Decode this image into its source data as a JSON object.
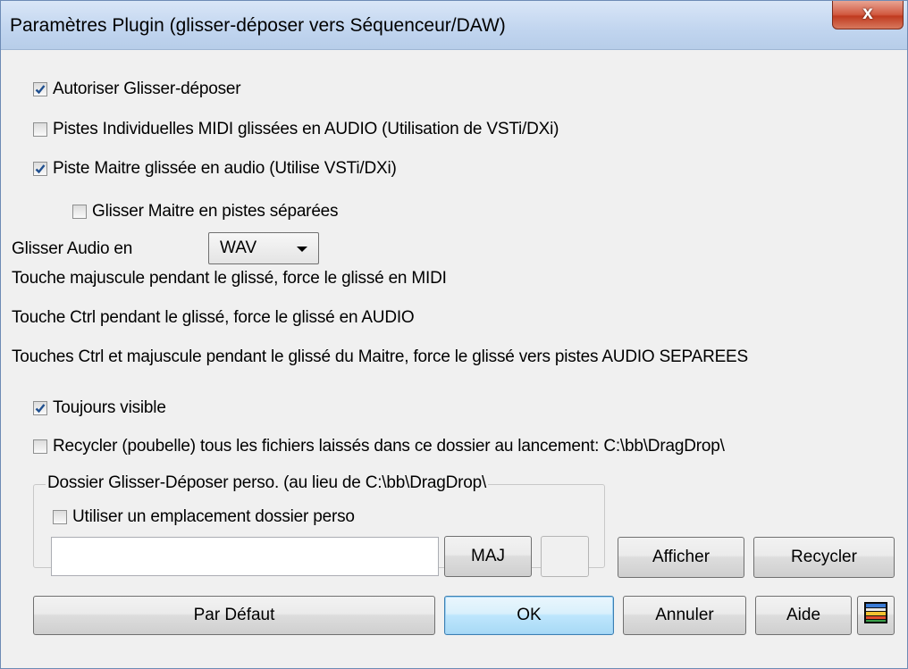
{
  "window": {
    "title": "Paramètres Plugin (glisser-déposer vers Séquenceur/DAW)",
    "close_label": "x"
  },
  "options": {
    "allow_drag_drop": {
      "label": "Autoriser Glisser-déposer",
      "checked": true
    },
    "individual_tracks_audio": {
      "label": "Pistes Individuelles MIDI glissées en AUDIO (Utilisation de VSTi/DXi)",
      "checked": false
    },
    "master_track_audio": {
      "label": "Piste Maitre glissée en audio (Utilise VSTi/DXi)",
      "checked": true
    },
    "master_separate_tracks": {
      "label": "Glisser Maitre en pistes séparées",
      "checked": false
    },
    "always_visible": {
      "label": "Toujours visible",
      "checked": true
    },
    "recycle_files": {
      "label": "Recycler (poubelle) tous les fichiers laissés dans ce dossier au lancement: C:\\bb\\DragDrop\\",
      "checked": false
    }
  },
  "audio_format": {
    "label": "Glisser Audio en",
    "selected": "WAV"
  },
  "info": {
    "shift_line": "Touche majuscule pendant le glissé, force le glissé en MIDI",
    "ctrl_line": "Touche Ctrl pendant le glissé, force le glissé en AUDIO",
    "ctrl_shift_line": "Touches Ctrl et majuscule pendant le glissé du Maitre, force le glissé vers pistes AUDIO SEPAREES"
  },
  "custom_folder": {
    "group_title": "Dossier Glisser-Déposer perso. (au lieu de C:\\bb\\DragDrop\\",
    "use_custom": {
      "label": "Utiliser un emplacement dossier perso",
      "checked": false
    },
    "path_value": "",
    "maj_button": "MAJ"
  },
  "buttons": {
    "show": "Afficher",
    "recycle": "Recycler",
    "default": "Par Défaut",
    "ok": "OK",
    "cancel": "Annuler",
    "help": "Aide"
  },
  "colors": {
    "titlebar": "#c1d5ef",
    "close": "#c03a1f",
    "check": "#1f4f8f",
    "dialog_bg": "#f0f0f0"
  }
}
